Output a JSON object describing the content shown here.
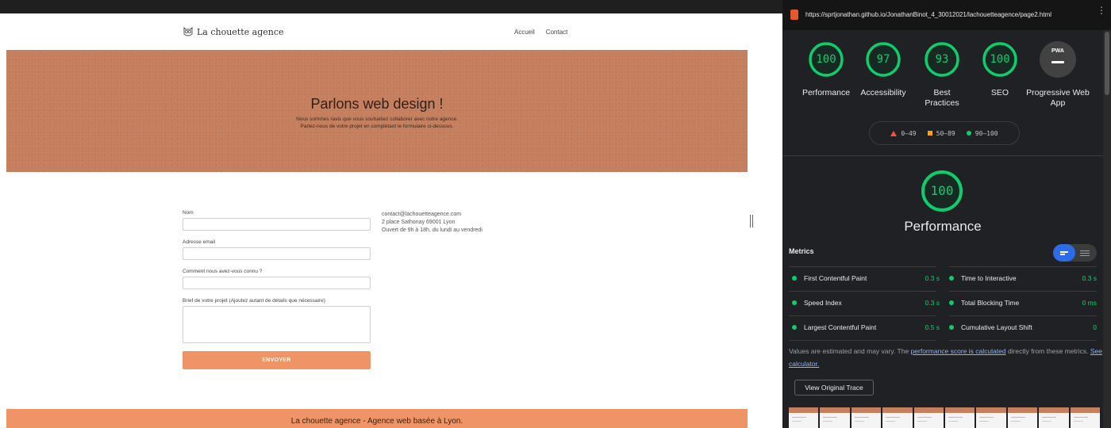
{
  "site": {
    "logo_text": "La chouette agence",
    "nav": [
      "Accueil",
      "Contact"
    ],
    "hero_title": "Parlons web design !",
    "hero_sub_1": "Nous sommes ravis que vous souhaitiez collaborer avec notre agence.",
    "hero_sub_2": "Parlez-nous de votre projet en complétant le formulaire ci-dessous.",
    "form": {
      "name_label": "Nom",
      "email_label": "Adresse email",
      "source_label": "Comment nous avez-vous connu ?",
      "brief_label": "Brief de votre projet (Ajoutez autant de détails que nécessaire)",
      "submit": "ENVOYER"
    },
    "contact": {
      "email": "contact@lachouetteagence.com",
      "address": "2 place Sathonay 69001 Lyon",
      "hours": "Ouvert de 9h à 18h, du lundi au vendredi"
    },
    "footer": "La chouette agence - Agence web basée à Lyon.",
    "colors": {
      "hero": "#c57f5f",
      "accent": "#ef9467"
    }
  },
  "lighthouse": {
    "url": "https://sprtjonathan.github.io/JonathanBinot_4_30012021/lachouetteagence/page2.html",
    "scores": [
      {
        "value": "100",
        "label": "Performance"
      },
      {
        "value": "97",
        "label": "Accessibility"
      },
      {
        "value": "93",
        "label": "Best Practices"
      },
      {
        "value": "100",
        "label": "SEO"
      }
    ],
    "pwa": {
      "badge": "PWA",
      "label": "Progressive Web App"
    },
    "legend": [
      "0–49",
      "50–89",
      "90–100"
    ],
    "perf_score": "100",
    "perf_title": "Performance",
    "metrics_title": "Metrics",
    "metrics": [
      {
        "name": "First Contentful Paint",
        "value": "0.3 s"
      },
      {
        "name": "Time to Interactive",
        "value": "0.3 s"
      },
      {
        "name": "Speed Index",
        "value": "0.3 s"
      },
      {
        "name": "Total Blocking Time",
        "value": "0 ms"
      },
      {
        "name": "Largest Contentful Paint",
        "value": "0.5 s"
      },
      {
        "name": "Cumulative Layout Shift",
        "value": "0"
      }
    ],
    "note_prefix": "Values are estimated and may vary. The ",
    "note_link": "performance score is calculated",
    "note_mid": " directly from these metrics. ",
    "note_calc": "See calculator.",
    "trace_button": "View Original Trace",
    "colors": {
      "pass": "#0cce6b",
      "average": "#ffa400",
      "fail": "#ff4e42",
      "toggle": "#2e6be6"
    }
  }
}
